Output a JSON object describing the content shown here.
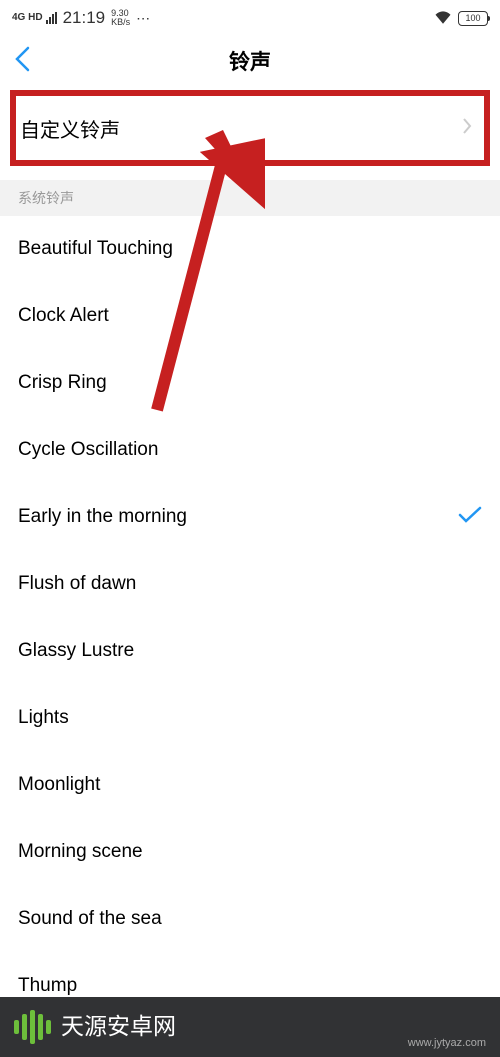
{
  "status": {
    "network": "4G HD",
    "time": "21:19",
    "speed_value": "9.30",
    "speed_unit": "KB/s",
    "battery": "100"
  },
  "nav": {
    "title": "铃声"
  },
  "custom": {
    "label": "自定义铃声"
  },
  "section": {
    "header": "系统铃声"
  },
  "ringtones": [
    {
      "label": "Beautiful Touching",
      "selected": false
    },
    {
      "label": "Clock Alert",
      "selected": false
    },
    {
      "label": "Crisp Ring",
      "selected": false
    },
    {
      "label": "Cycle Oscillation",
      "selected": false
    },
    {
      "label": "Early in the morning",
      "selected": true
    },
    {
      "label": "Flush of dawn",
      "selected": false
    },
    {
      "label": "Glassy Lustre",
      "selected": false
    },
    {
      "label": "Lights",
      "selected": false
    },
    {
      "label": "Moonlight",
      "selected": false
    },
    {
      "label": "Morning scene",
      "selected": false
    },
    {
      "label": "Sound of the sea",
      "selected": false
    },
    {
      "label": "Thump",
      "selected": false
    }
  ],
  "footer": {
    "brand": "天源安卓网",
    "url": "www.jytyaz.com"
  }
}
